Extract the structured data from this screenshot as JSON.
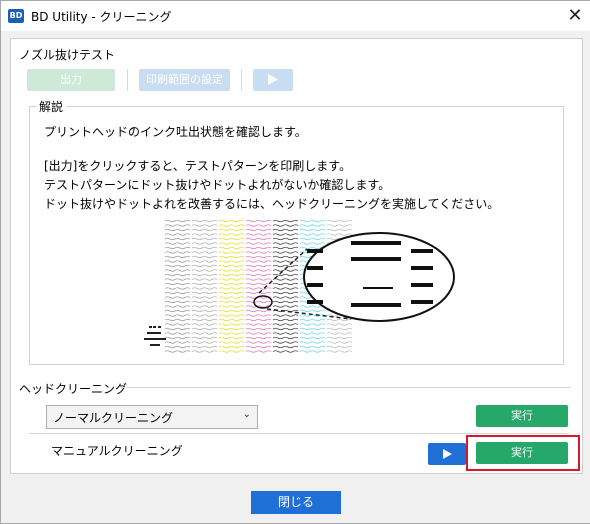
{
  "window": {
    "title": "BD Utility - クリーニング",
    "app_icon": "BD"
  },
  "nozzle_test": {
    "title": "ノズル抜けテスト",
    "output_label": "出力",
    "print_range_label": "印刷範囲の設定",
    "play_icon": "play-icon"
  },
  "explanation": {
    "legend": "解説",
    "lines": [
      "プリントヘッドのインク吐出状態を確認します。",
      "[出力]をクリックすると、テストパターンを印刷します。",
      "テストパターンにドット抜けやドットよれがないか確認します。",
      "ドット抜けやドットよれを改善するには、ヘッドクリーニングを実施してください。"
    ],
    "pattern_colors": [
      "#9a9a9a",
      "#b0b0b0",
      "#e6e020",
      "#e07ab8",
      "#404040",
      "#6fd6ef",
      "#bdbdbd"
    ]
  },
  "head_cleaning": {
    "title": "ヘッドクリーニング",
    "mode_selected": "ノーマルクリーニング",
    "execute_label": "実行",
    "manual_label": "マニュアルクリーニング",
    "manual_execute_label": "実行"
  },
  "footer": {
    "close_label": "閉じる"
  }
}
